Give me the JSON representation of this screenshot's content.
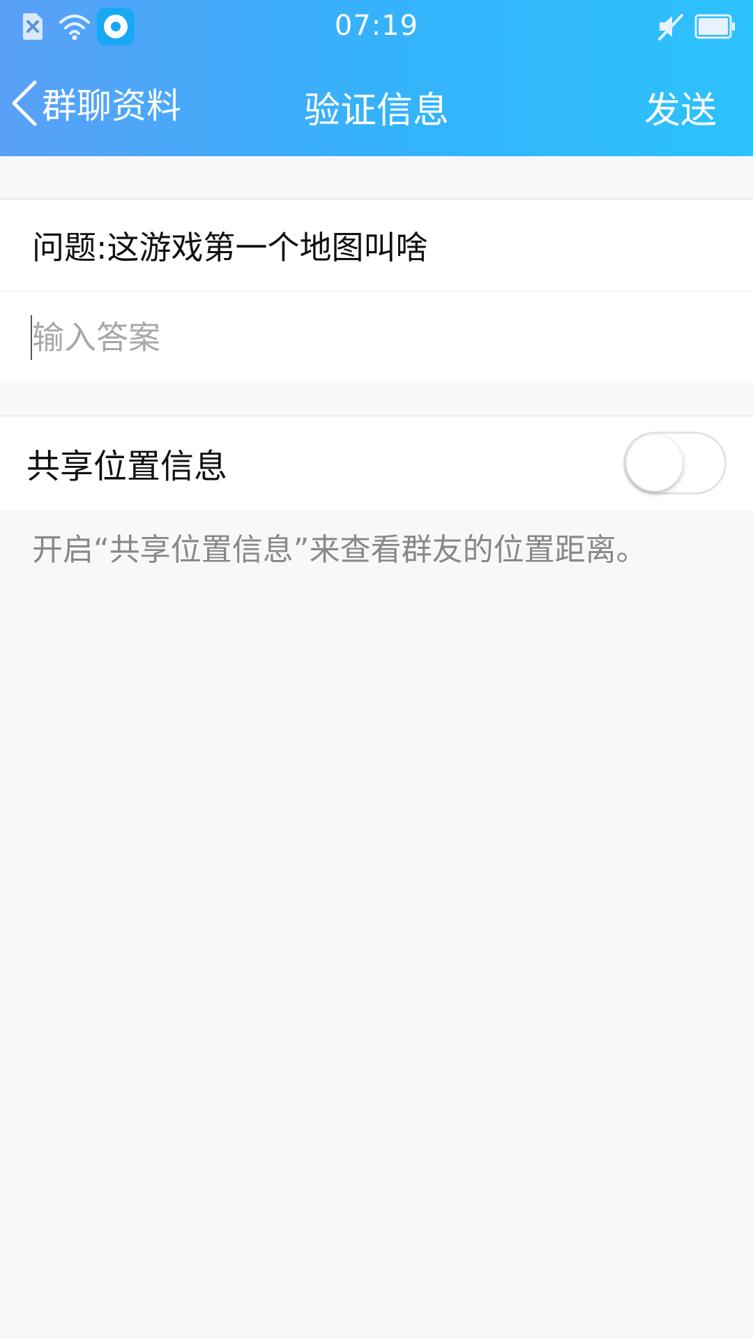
{
  "status_bar": {
    "time": "07:19",
    "icons": [
      "close-notification-icon",
      "wifi-icon",
      "app-notification-icon",
      "mute-icon",
      "battery-icon"
    ]
  },
  "nav": {
    "back_label": "群聊资料",
    "title": "验证信息",
    "send_label": "发送"
  },
  "form": {
    "question": "问题:这游戏第一个地图叫啥",
    "answer_value": "",
    "answer_placeholder": "输入答案"
  },
  "location": {
    "label": "共享位置信息",
    "enabled": false,
    "hint": "开启“共享位置信息”来查看群友的位置距离。"
  },
  "colors": {
    "header_gradient_start": "#5aa0f7",
    "header_gradient_end": "#2cc2fd",
    "background": "#f7f8fa",
    "hint_text": "#888888",
    "placeholder": "#a8a8a8"
  }
}
